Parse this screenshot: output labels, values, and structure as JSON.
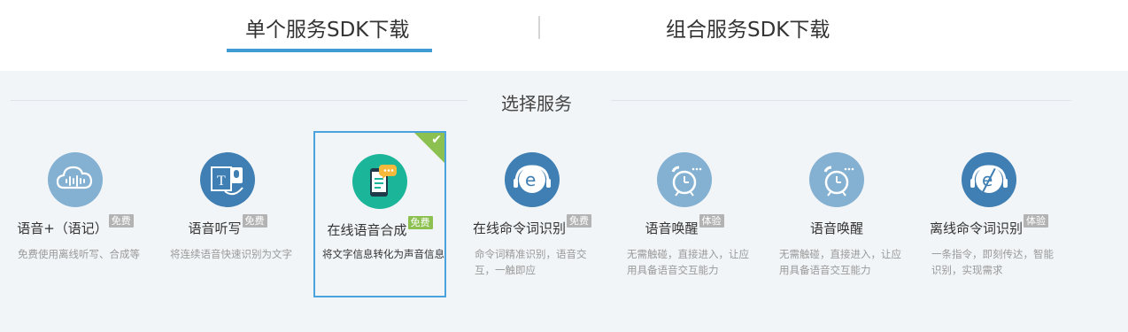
{
  "tabs": {
    "single": "单个服务SDK下载",
    "combo": "组合服务SDK下载"
  },
  "section": {
    "title": "选择服务"
  },
  "cards": [
    {
      "name": "语音+（语记）",
      "badge": "免费",
      "desc": "免费使用离线听写、合成等",
      "icon": "cloud-waveform-icon"
    },
    {
      "name": "语音听写",
      "badge": "免费",
      "desc": "将连续语音快速识别为文字",
      "icon": "dictation-microphone-icon"
    },
    {
      "name": "在线语音合成",
      "badge": "免费",
      "desc": "将文字信息转化为声音信息",
      "icon": "phone-chat-icon",
      "selected": true
    },
    {
      "name": "在线命令词识别",
      "badge": "免费",
      "desc": "命令词精准识别，语音交互，一触即应",
      "icon": "headset-e-icon"
    },
    {
      "name": "语音唤醒",
      "badge": "体验",
      "desc": "无需触碰，直接进入，让应用具备语音交互能力",
      "icon": "alarm-clock-icon"
    },
    {
      "name": "语音唤醒",
      "badge": "",
      "desc": "无需触碰，直接进入，让应用具备语音交互能力",
      "icon": "alarm-clock-icon"
    },
    {
      "name": "离线命令词识别",
      "badge": "体验",
      "desc": "一条指令，即刻传达，智能识别，实现需求",
      "icon": "offline-e-icon"
    }
  ],
  "colors": {
    "accent": "#3f9ad6",
    "free_badge": "#8cc152",
    "icon_blue": "#7fb2d6",
    "icon_teal": "#1bb59a"
  }
}
